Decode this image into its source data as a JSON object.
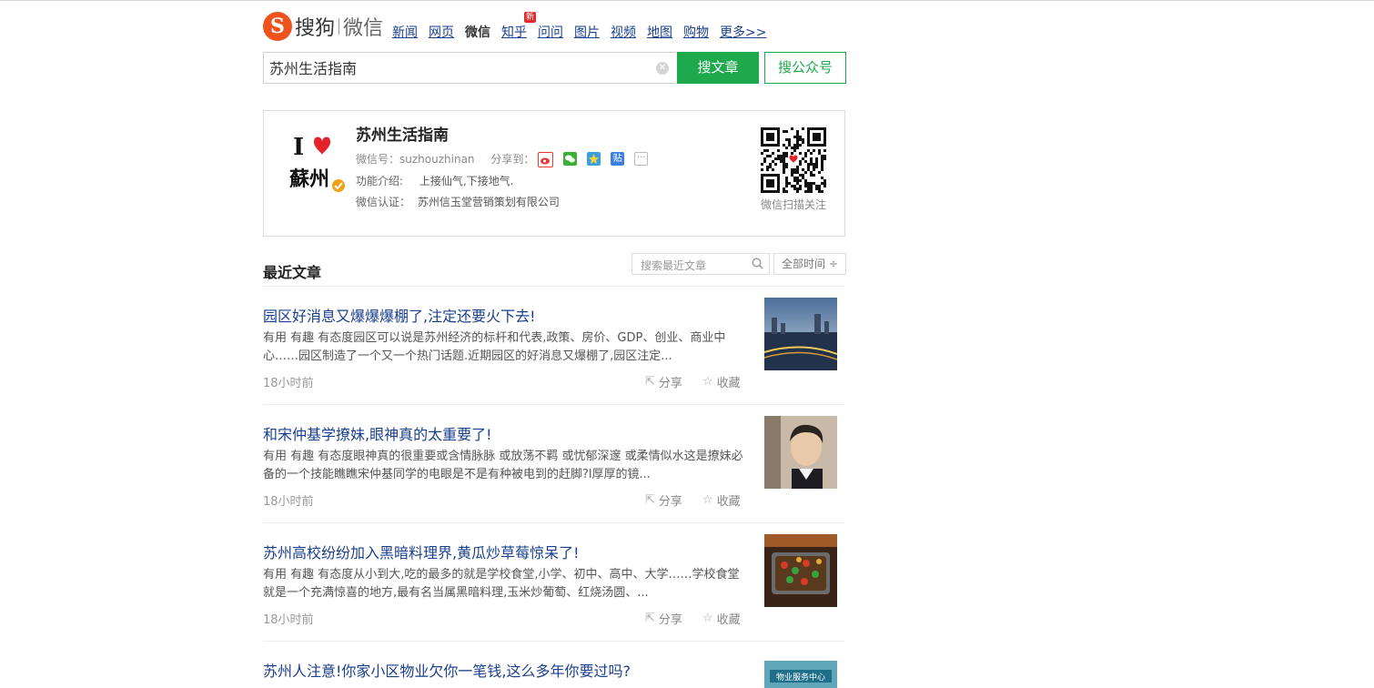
{
  "header": {
    "logo_text": "搜狗",
    "logo_sub": "微信",
    "nav": [
      "新闻",
      "网页",
      "微信",
      "知乎",
      "问问",
      "图片",
      "视频",
      "地图",
      "购物",
      "更多>>"
    ],
    "nav_active": "微信",
    "new_badge": "新"
  },
  "search": {
    "query": "苏州生活指南",
    "btn_article": "搜文章",
    "btn_account": "搜公众号"
  },
  "account": {
    "name": "苏州生活指南",
    "wechat_id_label": "微信号：",
    "wechat_id": "suzhouzhinan",
    "share_label": "分享到：",
    "intro_label": "功能介绍:",
    "intro": "上接仙气,下接地气.",
    "cert_label": "微信认证：",
    "cert": "苏州信玉堂营销策划有限公司",
    "qr_caption": "微信扫描关注",
    "avatar_text_top": "I",
    "avatar_text_bottom": "蘇州"
  },
  "recent": {
    "title": "最近文章",
    "search_placeholder": "搜索最近文章",
    "time_filter": "全部时间 ÷"
  },
  "articles": [
    {
      "title": "园区好消息又爆爆爆棚了,注定还要火下去!",
      "desc": "有用 有趣 有态度园区可以说是苏州经济的标杆和代表,政策、房价、GDP、创业、商业中心……园区制造了一个又一个热门话题.近期园区的好消息又爆棚了,园区注定...",
      "time": "18小时前",
      "share": "分享",
      "fav": "收藏"
    },
    {
      "title": "和宋仲基学撩妹,眼神真的太重要了!",
      "desc": "有用 有趣 有态度眼神真的很重要或含情脉脉 或放荡不羁 或忧郁深邃 或柔情似水这是撩妹必备的一个技能瞧瞧宋仲基同学的电眼是不是有种被电到的赶脚?l厚厚的镜...",
      "time": "18小时前",
      "share": "分享",
      "fav": "收藏"
    },
    {
      "title": "苏州高校纷纷加入黑暗料理界,黄瓜炒草莓惊呆了!",
      "desc": "有用 有趣 有态度从小到大,吃的最多的就是学校食堂,小学、初中、高中、大学……学校食堂就是一个充满惊喜的地方,最有名当属黑暗料理,玉米炒葡萄、红烧汤圆、...",
      "time": "18小时前",
      "share": "分享",
      "fav": "收藏"
    },
    {
      "title": "苏州人注意!你家小区物业欠你一笔钱,这么多年你要过吗?",
      "desc": "",
      "time": "",
      "share": "",
      "fav": "",
      "thumb_text": "物业服务中心"
    }
  ],
  "colors": {
    "green": "#1fa94d",
    "link": "#1a3f8c",
    "logo": "#f0521e"
  }
}
